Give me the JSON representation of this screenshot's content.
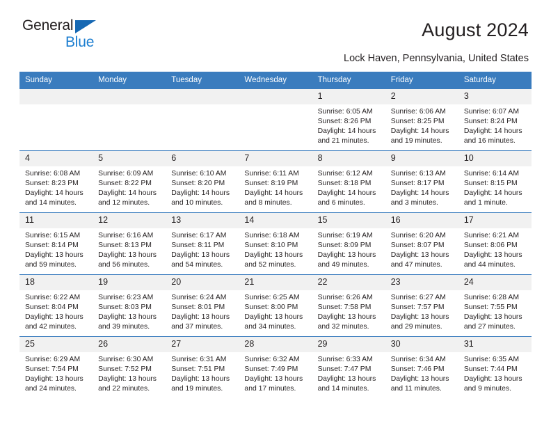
{
  "brand": {
    "name_part1": "General",
    "name_part2": "Blue",
    "triangle_color": "#1668b3",
    "blue_text_color": "#1c7ed0"
  },
  "header": {
    "title": "August 2024",
    "subtitle": "Lock Haven, Pennsylvania, United States"
  },
  "calendar": {
    "header_background": "#3a7cbe",
    "daynum_background": "#f1f1f1",
    "weekday_headers": [
      "Sunday",
      "Monday",
      "Tuesday",
      "Wednesday",
      "Thursday",
      "Friday",
      "Saturday"
    ],
    "weeks": [
      [
        {
          "day": "",
          "empty": true
        },
        {
          "day": "",
          "empty": true
        },
        {
          "day": "",
          "empty": true
        },
        {
          "day": "",
          "empty": true
        },
        {
          "day": "1",
          "sunrise": "Sunrise: 6:05 AM",
          "sunset": "Sunset: 8:26 PM",
          "daylight_line1": "Daylight: 14 hours",
          "daylight_line2": "and 21 minutes."
        },
        {
          "day": "2",
          "sunrise": "Sunrise: 6:06 AM",
          "sunset": "Sunset: 8:25 PM",
          "daylight_line1": "Daylight: 14 hours",
          "daylight_line2": "and 19 minutes."
        },
        {
          "day": "3",
          "sunrise": "Sunrise: 6:07 AM",
          "sunset": "Sunset: 8:24 PM",
          "daylight_line1": "Daylight: 14 hours",
          "daylight_line2": "and 16 minutes."
        }
      ],
      [
        {
          "day": "4",
          "sunrise": "Sunrise: 6:08 AM",
          "sunset": "Sunset: 8:23 PM",
          "daylight_line1": "Daylight: 14 hours",
          "daylight_line2": "and 14 minutes."
        },
        {
          "day": "5",
          "sunrise": "Sunrise: 6:09 AM",
          "sunset": "Sunset: 8:22 PM",
          "daylight_line1": "Daylight: 14 hours",
          "daylight_line2": "and 12 minutes."
        },
        {
          "day": "6",
          "sunrise": "Sunrise: 6:10 AM",
          "sunset": "Sunset: 8:20 PM",
          "daylight_line1": "Daylight: 14 hours",
          "daylight_line2": "and 10 minutes."
        },
        {
          "day": "7",
          "sunrise": "Sunrise: 6:11 AM",
          "sunset": "Sunset: 8:19 PM",
          "daylight_line1": "Daylight: 14 hours",
          "daylight_line2": "and 8 minutes."
        },
        {
          "day": "8",
          "sunrise": "Sunrise: 6:12 AM",
          "sunset": "Sunset: 8:18 PM",
          "daylight_line1": "Daylight: 14 hours",
          "daylight_line2": "and 6 minutes."
        },
        {
          "day": "9",
          "sunrise": "Sunrise: 6:13 AM",
          "sunset": "Sunset: 8:17 PM",
          "daylight_line1": "Daylight: 14 hours",
          "daylight_line2": "and 3 minutes."
        },
        {
          "day": "10",
          "sunrise": "Sunrise: 6:14 AM",
          "sunset": "Sunset: 8:15 PM",
          "daylight_line1": "Daylight: 14 hours",
          "daylight_line2": "and 1 minute."
        }
      ],
      [
        {
          "day": "11",
          "sunrise": "Sunrise: 6:15 AM",
          "sunset": "Sunset: 8:14 PM",
          "daylight_line1": "Daylight: 13 hours",
          "daylight_line2": "and 59 minutes."
        },
        {
          "day": "12",
          "sunrise": "Sunrise: 6:16 AM",
          "sunset": "Sunset: 8:13 PM",
          "daylight_line1": "Daylight: 13 hours",
          "daylight_line2": "and 56 minutes."
        },
        {
          "day": "13",
          "sunrise": "Sunrise: 6:17 AM",
          "sunset": "Sunset: 8:11 PM",
          "daylight_line1": "Daylight: 13 hours",
          "daylight_line2": "and 54 minutes."
        },
        {
          "day": "14",
          "sunrise": "Sunrise: 6:18 AM",
          "sunset": "Sunset: 8:10 PM",
          "daylight_line1": "Daylight: 13 hours",
          "daylight_line2": "and 52 minutes."
        },
        {
          "day": "15",
          "sunrise": "Sunrise: 6:19 AM",
          "sunset": "Sunset: 8:09 PM",
          "daylight_line1": "Daylight: 13 hours",
          "daylight_line2": "and 49 minutes."
        },
        {
          "day": "16",
          "sunrise": "Sunrise: 6:20 AM",
          "sunset": "Sunset: 8:07 PM",
          "daylight_line1": "Daylight: 13 hours",
          "daylight_line2": "and 47 minutes."
        },
        {
          "day": "17",
          "sunrise": "Sunrise: 6:21 AM",
          "sunset": "Sunset: 8:06 PM",
          "daylight_line1": "Daylight: 13 hours",
          "daylight_line2": "and 44 minutes."
        }
      ],
      [
        {
          "day": "18",
          "sunrise": "Sunrise: 6:22 AM",
          "sunset": "Sunset: 8:04 PM",
          "daylight_line1": "Daylight: 13 hours",
          "daylight_line2": "and 42 minutes."
        },
        {
          "day": "19",
          "sunrise": "Sunrise: 6:23 AM",
          "sunset": "Sunset: 8:03 PM",
          "daylight_line1": "Daylight: 13 hours",
          "daylight_line2": "and 39 minutes."
        },
        {
          "day": "20",
          "sunrise": "Sunrise: 6:24 AM",
          "sunset": "Sunset: 8:01 PM",
          "daylight_line1": "Daylight: 13 hours",
          "daylight_line2": "and 37 minutes."
        },
        {
          "day": "21",
          "sunrise": "Sunrise: 6:25 AM",
          "sunset": "Sunset: 8:00 PM",
          "daylight_line1": "Daylight: 13 hours",
          "daylight_line2": "and 34 minutes."
        },
        {
          "day": "22",
          "sunrise": "Sunrise: 6:26 AM",
          "sunset": "Sunset: 7:58 PM",
          "daylight_line1": "Daylight: 13 hours",
          "daylight_line2": "and 32 minutes."
        },
        {
          "day": "23",
          "sunrise": "Sunrise: 6:27 AM",
          "sunset": "Sunset: 7:57 PM",
          "daylight_line1": "Daylight: 13 hours",
          "daylight_line2": "and 29 minutes."
        },
        {
          "day": "24",
          "sunrise": "Sunrise: 6:28 AM",
          "sunset": "Sunset: 7:55 PM",
          "daylight_line1": "Daylight: 13 hours",
          "daylight_line2": "and 27 minutes."
        }
      ],
      [
        {
          "day": "25",
          "sunrise": "Sunrise: 6:29 AM",
          "sunset": "Sunset: 7:54 PM",
          "daylight_line1": "Daylight: 13 hours",
          "daylight_line2": "and 24 minutes."
        },
        {
          "day": "26",
          "sunrise": "Sunrise: 6:30 AM",
          "sunset": "Sunset: 7:52 PM",
          "daylight_line1": "Daylight: 13 hours",
          "daylight_line2": "and 22 minutes."
        },
        {
          "day": "27",
          "sunrise": "Sunrise: 6:31 AM",
          "sunset": "Sunset: 7:51 PM",
          "daylight_line1": "Daylight: 13 hours",
          "daylight_line2": "and 19 minutes."
        },
        {
          "day": "28",
          "sunrise": "Sunrise: 6:32 AM",
          "sunset": "Sunset: 7:49 PM",
          "daylight_line1": "Daylight: 13 hours",
          "daylight_line2": "and 17 minutes."
        },
        {
          "day": "29",
          "sunrise": "Sunrise: 6:33 AM",
          "sunset": "Sunset: 7:47 PM",
          "daylight_line1": "Daylight: 13 hours",
          "daylight_line2": "and 14 minutes."
        },
        {
          "day": "30",
          "sunrise": "Sunrise: 6:34 AM",
          "sunset": "Sunset: 7:46 PM",
          "daylight_line1": "Daylight: 13 hours",
          "daylight_line2": "and 11 minutes."
        },
        {
          "day": "31",
          "sunrise": "Sunrise: 6:35 AM",
          "sunset": "Sunset: 7:44 PM",
          "daylight_line1": "Daylight: 13 hours",
          "daylight_line2": "and 9 minutes."
        }
      ]
    ]
  }
}
